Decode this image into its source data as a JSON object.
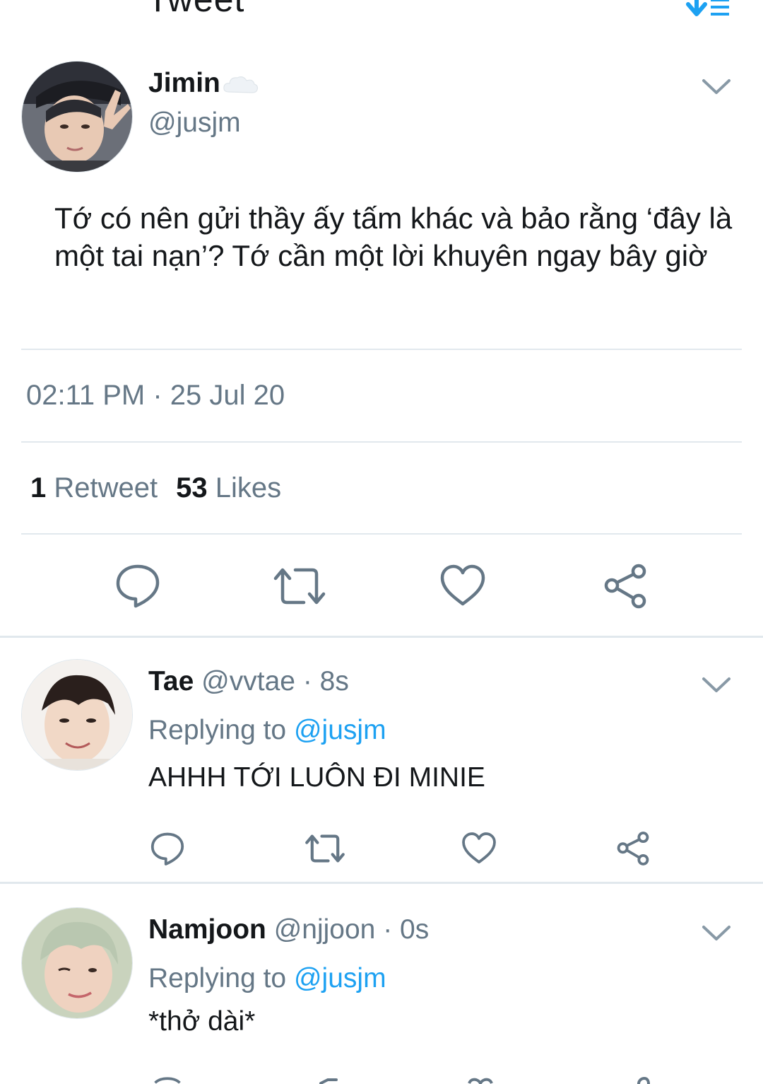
{
  "header": {
    "title": "Tweet"
  },
  "main_tweet": {
    "name": "Jimin",
    "handle": "@jusjm",
    "text": "Tớ có nên gửi thầy ấy tấm khác và bảo rằng ‘đây là một tai nạn’? Tớ cần một lời khuyên ngay bây giờ",
    "timestamp": "02:11 PM · 25 Jul 20",
    "retweet_count": "1",
    "retweet_label": "Retweet",
    "like_count": "53",
    "like_label": "Likes"
  },
  "replies": [
    {
      "name": "Tae",
      "handle": "@vvtae",
      "time": "· 8s",
      "replying_prefix": "Replying to",
      "replying_to": "@jusjm",
      "text": "AHHH TỚI LUÔN ĐI MINIE"
    },
    {
      "name": "Namjoon",
      "handle": "@njjoon",
      "time": "· 0s",
      "replying_prefix": "Replying to",
      "replying_to": "@jusjm",
      "text": "*thở dài*"
    }
  ],
  "icons": {
    "back": "arrow-left-icon",
    "sort": "sort-icon",
    "chevron": "chevron-down-icon",
    "reply": "comment-icon",
    "retweet": "retweet-icon",
    "like": "heart-icon",
    "share": "share-icon",
    "name_badge": "cloud-icon"
  },
  "colors": {
    "accent": "#1da1f2",
    "secondary_text": "#657786",
    "primary_text": "#14171a",
    "divider": "#e1e8ed"
  }
}
